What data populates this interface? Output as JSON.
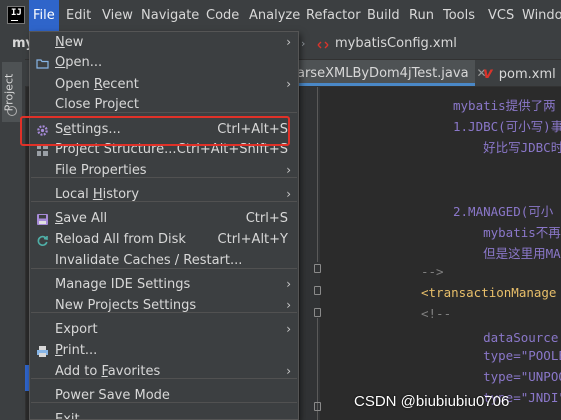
{
  "menubar": {
    "items": [
      "File",
      "Edit",
      "View",
      "Navigate",
      "Code",
      "Analyze",
      "Refactor",
      "Build",
      "Run",
      "Tools",
      "VCS",
      "Window"
    ]
  },
  "project": {
    "name": "my",
    "breadcrumb_file": "mybatisConfig.xml"
  },
  "tabs": [
    {
      "label": "arseXMLByDom4jTest.java"
    },
    {
      "label": "pom.xml (s"
    }
  ],
  "toolwindow": {
    "project_label": "Project"
  },
  "file_menu": {
    "items": [
      {
        "label": "New",
        "shortcut": "",
        "submenu": true,
        "icon": ""
      },
      {
        "label": "Open...",
        "shortcut": "",
        "submenu": false,
        "icon": "folder-icon"
      },
      {
        "label": "Open Recent",
        "shortcut": "",
        "submenu": true,
        "icon": ""
      },
      {
        "label": "Close Project",
        "shortcut": "",
        "submenu": false,
        "icon": ""
      },
      {
        "label": "Settings...",
        "shortcut": "Ctrl+Alt+S",
        "submenu": false,
        "icon": "gear-icon"
      },
      {
        "label": "Project Structure...",
        "shortcut": "Ctrl+Alt+Shift+S",
        "submenu": false,
        "icon": "project-structure-icon"
      },
      {
        "label": "File Properties",
        "shortcut": "",
        "submenu": true,
        "icon": ""
      },
      {
        "label": "Local History",
        "shortcut": "",
        "submenu": true,
        "icon": ""
      },
      {
        "label": "Save All",
        "shortcut": "Ctrl+S",
        "submenu": false,
        "icon": "save-icon"
      },
      {
        "label": "Reload All from Disk",
        "shortcut": "Ctrl+Alt+Y",
        "submenu": false,
        "icon": "reload-icon"
      },
      {
        "label": "Invalidate Caches / Restart...",
        "shortcut": "",
        "submenu": false,
        "icon": ""
      },
      {
        "label": "Manage IDE Settings",
        "shortcut": "",
        "submenu": true,
        "icon": ""
      },
      {
        "label": "New Projects Settings",
        "shortcut": "",
        "submenu": true,
        "icon": ""
      },
      {
        "label": "Export",
        "shortcut": "",
        "submenu": true,
        "icon": ""
      },
      {
        "label": "Print...",
        "shortcut": "",
        "submenu": false,
        "icon": "print-icon"
      },
      {
        "label": "Add to Favorites",
        "shortcut": "",
        "submenu": true,
        "icon": ""
      },
      {
        "label": "Power Save Mode",
        "shortcut": "",
        "submenu": false,
        "icon": ""
      },
      {
        "label": "Exit",
        "shortcut": "",
        "submenu": false,
        "icon": ""
      }
    ]
  },
  "editor": {
    "lines": [
      {
        "text": "mybatis提供了两",
        "class": "c-comment"
      },
      {
        "text": "1.JDBC(可小写)事",
        "class": "c-comment"
      },
      {
        "text": "    好比写JDBC时",
        "class": "c-comment"
      },
      {
        "text": "2.MANAGED(可小",
        "class": "c-comment"
      },
      {
        "text": "    mybatis不再",
        "class": "c-comment"
      },
      {
        "text": "    但是这里用MA",
        "class": "c-comment"
      },
      {
        "text": "-->",
        "class": "c-grey"
      },
      {
        "text": "<transactionManage",
        "class": "c-tag"
      },
      {
        "text": "<!--",
        "class": "c-grey"
      },
      {
        "text": "    dataSource:数据",
        "class": "c-comment"
      },
      {
        "text": "    type=\"POOLED\"",
        "class": "c-comment"
      },
      {
        "text": "    type=\"UNPOOLED",
        "class": "c-comment"
      },
      {
        "text": "    type=\"JNDI\" JN",
        "class": "c-comment"
      }
    ]
  },
  "watermark": "CSDN @biubiubiu0706",
  "colors": {
    "accent": "#2f65ca",
    "highlight_box": "#e03128",
    "background": "#2b2b2b",
    "panel": "#3c3f41"
  }
}
